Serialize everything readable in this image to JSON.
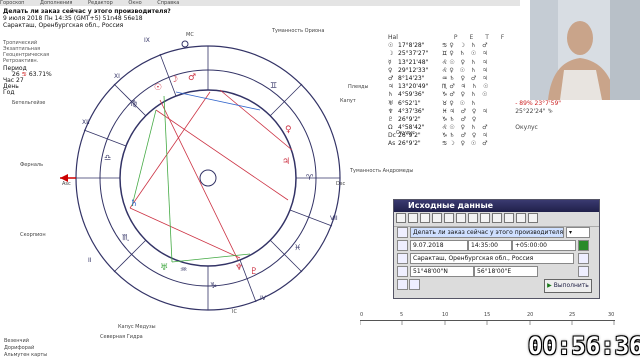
{
  "menubar": [
    "Гороскоп",
    "Дополнения",
    "Редактор",
    "Окно",
    "Справка"
  ],
  "header": {
    "question": "Делать ли заказ сейчас у этого производителя?",
    "datetime": "9 июля 2018  Пн  14:35 (GMT+5) 51n48  56e18",
    "place": "Саракташ, Оренбургская обл., Россия",
    "house_systems": [
      "Тропический",
      "Экзаптильная",
      "Геоцентрическая",
      "Ретроактивн."
    ],
    "period_label": "Период",
    "period_value": "26",
    "percent": "63.71%",
    "hour_label": "Час",
    "hour_value": "27",
    "day_label": "День",
    "year_label": "Год"
  },
  "chart_labels": {
    "mc": "MC",
    "ic": "IC",
    "asc": "Asc",
    "dsc": "Dsc",
    "houses": [
      "I",
      "II",
      "III",
      "IV",
      "V",
      "VI",
      "VII",
      "VIII",
      "IX",
      "X",
      "XI",
      "XII"
    ],
    "stars": [
      "Туманность Ориона",
      "Плеяды",
      "Капут",
      "Окулус",
      "Туманность Андромеды",
      "Ферналь",
      "Бетельгейзе",
      "Капус Медузы",
      "Скорпион",
      "Северная Гидра"
    ],
    "bottom_left": [
      "Везенчий",
      "Дорифорай",
      "Альмутен карты"
    ]
  },
  "planets_table": {
    "header": [
      "Hal",
      "P",
      "E",
      "T",
      "F"
    ],
    "rows": [
      {
        "sym": "☉",
        "deg": "17°8'28\"",
        "sign": "♋"
      },
      {
        "sym": "☽",
        "deg": "25°37'27\"",
        "sign": "♊"
      },
      {
        "sym": "☿",
        "deg": "13°21'48\"",
        "sign": "♌"
      },
      {
        "sym": "♀",
        "deg": "29°12'33\"",
        "sign": "♌"
      },
      {
        "sym": "♂",
        "deg": "8°14'23\"",
        "sign": "♒"
      },
      {
        "sym": "♃",
        "deg": "13°20'49\"",
        "sign": "♏"
      },
      {
        "sym": "♄",
        "deg": "4°59'36\"",
        "sign": "♑"
      },
      {
        "sym": "♅",
        "deg": "6°52'1\"",
        "sign": "♉"
      },
      {
        "sym": "♆",
        "deg": "4°37'36\"",
        "sign": "♓"
      },
      {
        "sym": "♇",
        "deg": "26°9'2\"",
        "sign": "♑"
      },
      {
        "sym": "Ω",
        "deg": "4°58'42\"",
        "sign": "♌"
      },
      {
        "sym": "Dc",
        "deg": "26°9'2\"",
        "sign": "♑"
      },
      {
        "sym": "As",
        "deg": "26°9'2\"",
        "sign": "♋"
      }
    ],
    "extra": [
      "- 89%  23°7'59\"",
      "25°22'24\" ♑"
    ],
    "oculus": "Окулус"
  },
  "dialog": {
    "title": "Исходные данные",
    "question": "Делать ли заказ сейчас у этого производителя?",
    "date": "9.07.2018",
    "time": "14:35:00",
    "tz": "+05:00:00",
    "place": "Саракташ, Оренбургская обл., Россия",
    "lat": "51°48'00\"N",
    "lon": "56°18'00\"E",
    "run_button": "Выполнить"
  },
  "ruler_ticks": [
    "0",
    "5",
    "10",
    "15",
    "20",
    "25",
    "30"
  ],
  "timer": "00:56:36",
  "colors": {
    "aspect_red": "#cc3344",
    "aspect_green": "#44aa44",
    "ring": "#333366",
    "accent": "#3366cc"
  }
}
